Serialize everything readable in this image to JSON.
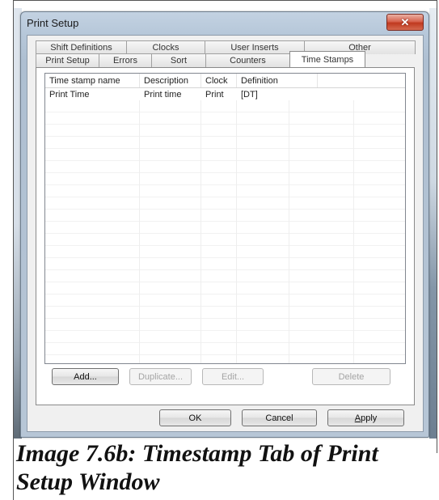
{
  "dialog": {
    "title": "Print Setup",
    "close_glyph": "✕"
  },
  "tabs": {
    "back_row": [
      "Shift Definitions",
      "Clocks",
      "User Inserts",
      "Other"
    ],
    "front_row": [
      "Print Setup",
      "Errors",
      "Sort",
      "Counters",
      "Time Stamps"
    ],
    "active": "Time Stamps"
  },
  "list": {
    "columns": [
      "Time stamp name",
      "Description",
      "Clock",
      "Definition"
    ],
    "rows": [
      [
        "Print Time",
        "Print time",
        "Print",
        "[DT]"
      ]
    ]
  },
  "panel_buttons": {
    "add": "Add...",
    "duplicate": "Duplicate...",
    "edit": "Edit...",
    "delete": "Delete"
  },
  "dialog_buttons": {
    "ok": "OK",
    "cancel": "Cancel",
    "apply_first": "A",
    "apply_rest": "pply"
  },
  "caption": "Image 7.6b: Timestamp Tab of Print Setup Window",
  "colors": {
    "close_button": "#c0391f",
    "window_frame": "#b6c7d9"
  }
}
